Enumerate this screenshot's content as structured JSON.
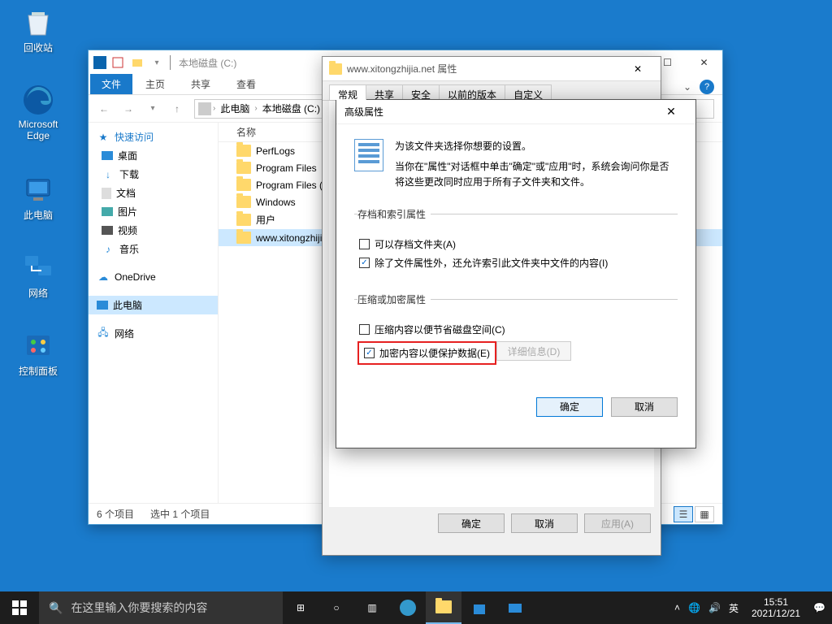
{
  "desktop": {
    "icons": [
      {
        "label": "回收站"
      },
      {
        "label": "Microsoft Edge"
      },
      {
        "label": "此电脑"
      },
      {
        "label": "网络"
      },
      {
        "label": "控制面板"
      }
    ]
  },
  "explorer": {
    "title": "本地磁盘 (C:)",
    "tabs": {
      "file": "文件",
      "home": "主页",
      "share": "共享",
      "view": "查看"
    },
    "breadcrumb": [
      "此电脑",
      "本地磁盘 (C:)"
    ],
    "column_header": "名称",
    "sidebar": {
      "quick": "快速访问",
      "items": [
        "桌面",
        "下载",
        "文档",
        "图片",
        "视频",
        "音乐"
      ],
      "onedrive": "OneDrive",
      "this_pc": "此电脑",
      "network": "网络"
    },
    "files": [
      "PerfLogs",
      "Program Files",
      "Program Files (x86)",
      "Windows",
      "用户",
      "www.xitongzhijia.net"
    ],
    "status": {
      "count": "6 个项目",
      "selected": "选中 1 个项目"
    }
  },
  "props": {
    "title": "www.xitongzhijia.net 属性",
    "tabs": [
      "常规",
      "共享",
      "安全",
      "以前的版本",
      "自定义"
    ],
    "buttons": {
      "ok": "确定",
      "cancel": "取消",
      "apply": "应用(A)"
    }
  },
  "adv": {
    "title": "高级属性",
    "heading": "为该文件夹选择你想要的设置。",
    "desc": "当你在\"属性\"对话框中单击\"确定\"或\"应用\"时，系统会询问你是否将这些更改同时应用于所有子文件夹和文件。",
    "group1": {
      "legend": "存档和索引属性",
      "chk1": "可以存档文件夹(A)",
      "chk2": "除了文件属性外，还允许索引此文件夹中文件的内容(I)"
    },
    "group2": {
      "legend": "压缩或加密属性",
      "chk1": "压缩内容以便节省磁盘空间(C)",
      "chk2": "加密内容以便保护数据(E)",
      "detail": "详细信息(D)"
    },
    "buttons": {
      "ok": "确定",
      "cancel": "取消"
    }
  },
  "taskbar": {
    "search_placeholder": "在这里输入你要搜索的内容",
    "ime": "英",
    "time": "15:51",
    "date": "2021/12/21"
  }
}
